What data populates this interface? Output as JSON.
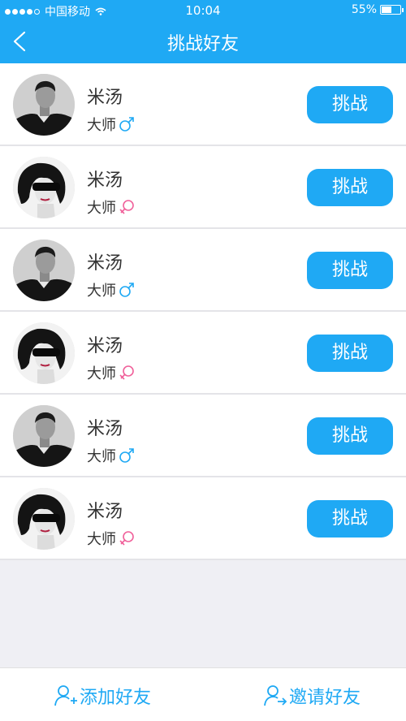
{
  "status_bar": {
    "carrier": "中国移动",
    "time": "10:04",
    "battery": "55%",
    "battery_level": 0.55
  },
  "header": {
    "title": "挑战好友"
  },
  "friends": [
    {
      "name": "米汤",
      "rank": "大师",
      "gender": "male",
      "button": "挑战"
    },
    {
      "name": "米汤",
      "rank": "大师",
      "gender": "female",
      "button": "挑战"
    },
    {
      "name": "米汤",
      "rank": "大师",
      "gender": "male",
      "button": "挑战"
    },
    {
      "name": "米汤",
      "rank": "大师",
      "gender": "female",
      "button": "挑战"
    },
    {
      "name": "米汤",
      "rank": "大师",
      "gender": "male",
      "button": "挑战"
    },
    {
      "name": "米汤",
      "rank": "大师",
      "gender": "female",
      "button": "挑战"
    }
  ],
  "bottom": {
    "add_friend": "添加好友",
    "invite_friend": "邀请好友"
  },
  "colors": {
    "accent": "#1fa9f4",
    "male": "#1fa9f4",
    "female": "#f0609a"
  }
}
